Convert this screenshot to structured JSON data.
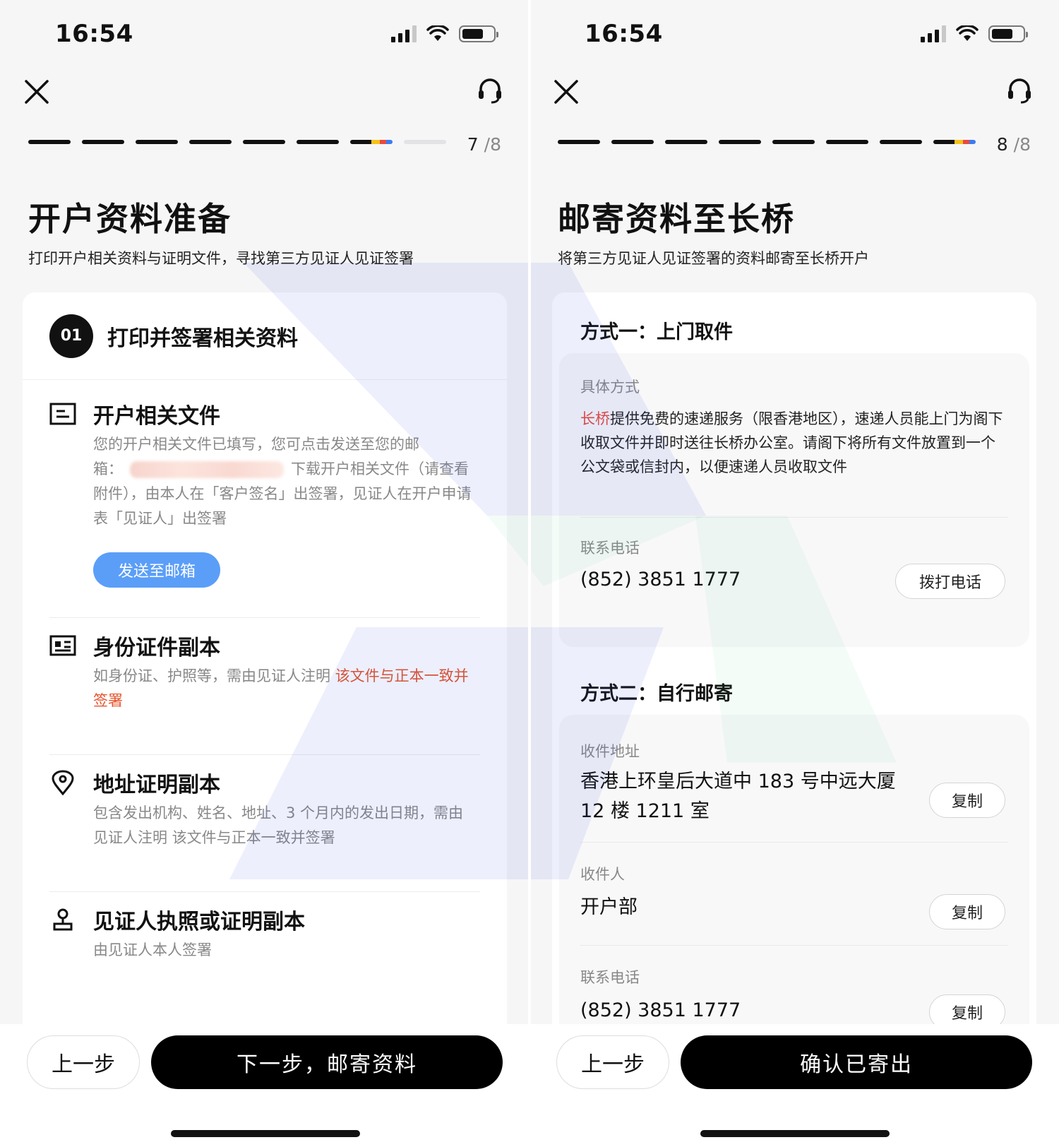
{
  "left": {
    "status": {
      "time": "16:54"
    },
    "step": {
      "current": "7",
      "total": "/8"
    },
    "title": "开户资料准备",
    "subtitle": "打印开户相关资料与证明文件，寻找第三方见证人见证签署",
    "card": {
      "badge": "01",
      "heading": "打印并签署相关资料",
      "docs": [
        {
          "icon": "document-icon",
          "title": "开户相关文件",
          "desc_line1": "您的开户相关文件已填写，您可点击发送至您的邮",
          "desc_prefix": "箱：",
          "desc_after_blur": "下载开户相关文件（请查",
          "desc_rest": "看附件），由本人在「客户签名」出签署，见证人在开户申请表「见证人」出签署",
          "button": "发送至邮箱"
        },
        {
          "icon": "id-card-icon",
          "title": "身份证件副本",
          "desc_plain": "如身份证、护照等，需由见证人注明 ",
          "desc_highlight": "该文件与正本一致并签署"
        },
        {
          "icon": "location-pin-icon",
          "title": "地址证明副本",
          "desc": "包含发出机构、姓名、地址、3 个月内的发出日期，需由见证人注明 该文件与正本一致并签署"
        },
        {
          "icon": "person-icon",
          "title": "见证人执照或证明副本",
          "desc": "由见证人本人签署"
        }
      ]
    },
    "footer": {
      "prev": "上一步",
      "next": "下一步，邮寄资料"
    }
  },
  "right": {
    "status": {
      "time": "16:54"
    },
    "step": {
      "current": "8",
      "total": "/8"
    },
    "title": "邮寄资料至长桥",
    "subtitle": "将第三方见证人见证签署的资料邮寄至长桥开户",
    "method1": {
      "title": "方式一：上门取件",
      "detail_label": "具体方式",
      "detail_brand": "长桥",
      "detail_text": "提供免费的速递服务（限香港地区），速递人员能上门为阁下收取文件并即时送往长桥办公室。请阁下将所有文件放置到一个公文袋或信封内，以便速递人员收取文件",
      "phone_label": "联系电话",
      "phone": "(852) 3851 1777",
      "call_button": "拨打电话"
    },
    "method2": {
      "title": "方式二：自行邮寄",
      "address_label": "收件地址",
      "address_line1": "香港上环皇后大道中 183 号中远大厦",
      "address_line2": "12 楼 1211 室",
      "recipient_label": "收件人",
      "recipient": "开户部",
      "phone_label": "联系电话",
      "phone": "(852) 3851 1777",
      "copy_button": "复制"
    },
    "footer": {
      "prev": "上一步",
      "next": "确认已寄出"
    }
  },
  "colors": {
    "accent_blue": "#5b9ef8",
    "highlight_orange": "#e4542c",
    "brand_red": "#e84a3c"
  }
}
